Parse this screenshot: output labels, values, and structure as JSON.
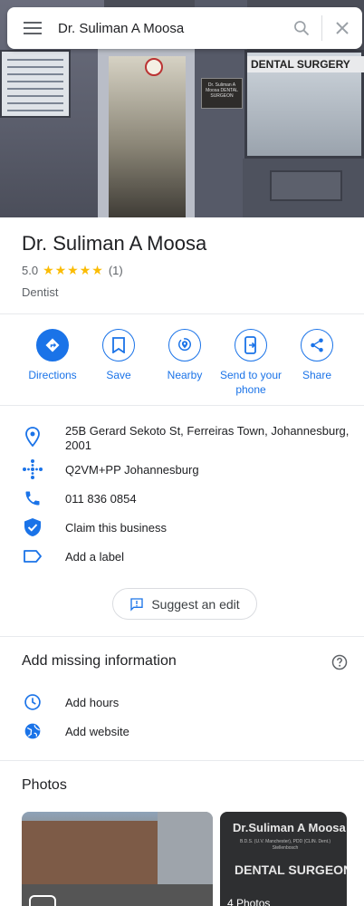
{
  "search": {
    "query": "Dr. Suliman A Moosa"
  },
  "hero": {
    "sign_right": "DENTAL SURGERY",
    "plaque": "Dr. Suliman A Moosa DENTAL SURGEON"
  },
  "place": {
    "name": "Dr. Suliman A Moosa",
    "rating": "5.0",
    "stars": "★★★★★",
    "review_count": "(1)",
    "category": "Dentist"
  },
  "actions": [
    {
      "label": "Directions",
      "icon": "directions-icon"
    },
    {
      "label": "Save",
      "icon": "bookmark-icon"
    },
    {
      "label": "Nearby",
      "icon": "nearby-icon"
    },
    {
      "label": "Send to your phone",
      "icon": "send-to-phone-icon"
    },
    {
      "label": "Share",
      "icon": "share-icon"
    }
  ],
  "info": {
    "address": "25B Gerard Sekoto St, Ferreiras Town, Johannesburg, 2001",
    "plus_code": "Q2VM+PP Johannesburg",
    "phone": "011 836 0854",
    "claim": "Claim this business",
    "label": "Add a label"
  },
  "suggest_edit": "Suggest an edit",
  "missing": {
    "title": "Add missing information",
    "hours": "Add hours",
    "website": "Add website"
  },
  "photos": {
    "title": "Photos",
    "sign_line1": "Dr.Suliman A Moosa",
    "sign_line2": "B.D.S. (U.V. Manchester), PDD (CLIN. Dent.) Stellenbosch",
    "sign_line3": "DENTAL SURGEON",
    "count_label": "4 Photos"
  },
  "colors": {
    "accent": "#1a73e8",
    "star": "#fbbc04",
    "text": "#202124",
    "muted": "#5f6368"
  }
}
